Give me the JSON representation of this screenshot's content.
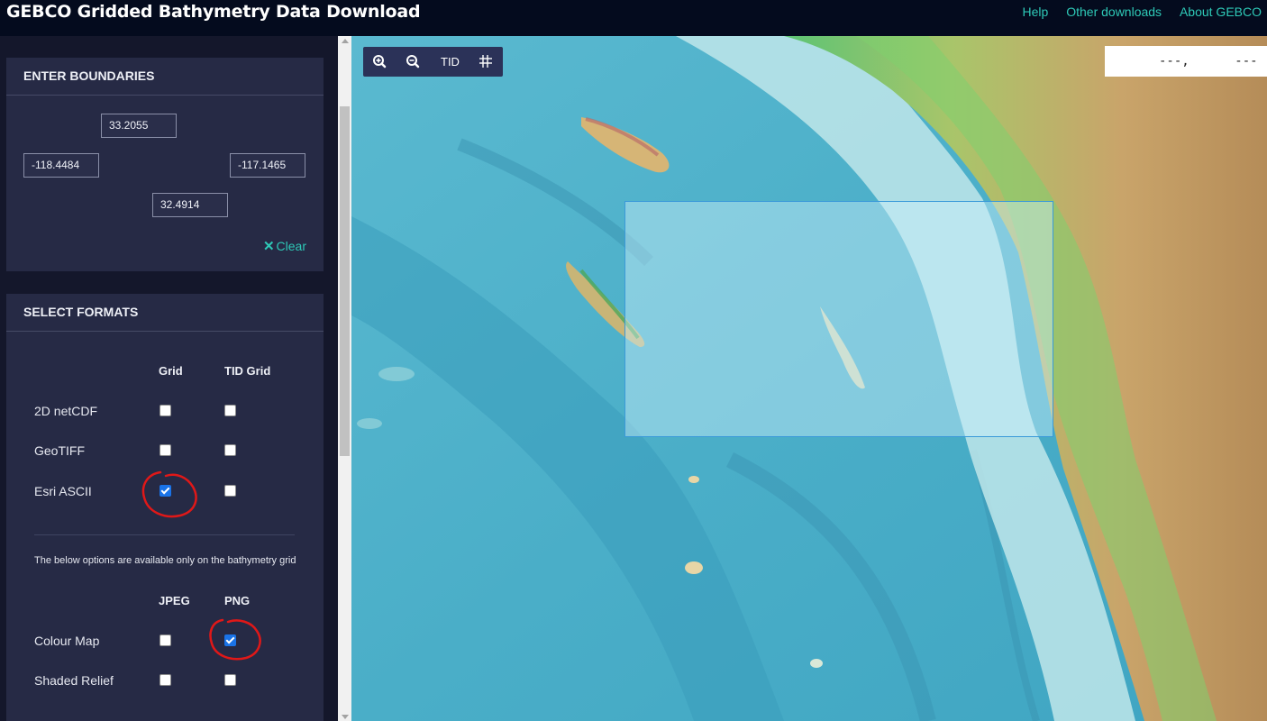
{
  "header": {
    "title": "GEBCO Gridded Bathymetry Data Download",
    "nav": [
      "Help",
      "Other downloads",
      "About GEBCO"
    ]
  },
  "boundaries": {
    "heading": "ENTER BOUNDARIES",
    "north": "33.2055",
    "west": "-118.4484",
    "east": "-117.1465",
    "south": "32.4914",
    "clear_label": "Clear"
  },
  "formats": {
    "heading": "SELECT FORMATS",
    "grid_columns": [
      "Grid",
      "TID Grid"
    ],
    "grid_rows": [
      {
        "label": "2D netCDF",
        "grid": false,
        "tid": false
      },
      {
        "label": "GeoTIFF",
        "grid": false,
        "tid": false
      },
      {
        "label": "Esri ASCII",
        "grid": true,
        "tid": false
      }
    ],
    "note": "The below options are available only on the bathymetry grid",
    "image_columns": [
      "JPEG",
      "PNG"
    ],
    "image_rows": [
      {
        "label": "Colour Map",
        "jpeg": false,
        "png": true
      },
      {
        "label": "Shaded Relief",
        "jpeg": false,
        "png": false
      }
    ]
  },
  "map": {
    "toolbar": {
      "zoom_in": "zoom-in-icon",
      "zoom_out": "zoom-out-icon",
      "tid_label": "TID",
      "grid": "grid-icon"
    },
    "coordinates": "---,      ---"
  },
  "colors": {
    "accent": "#2ec9b7",
    "header_bg": "#040b1e",
    "panel_bg": "#262a45",
    "sidebar_bg": "#14172b",
    "annotation": "#e01818",
    "checkbox_checked": "#1a73e8",
    "selection_border": "#3a9ad9"
  }
}
